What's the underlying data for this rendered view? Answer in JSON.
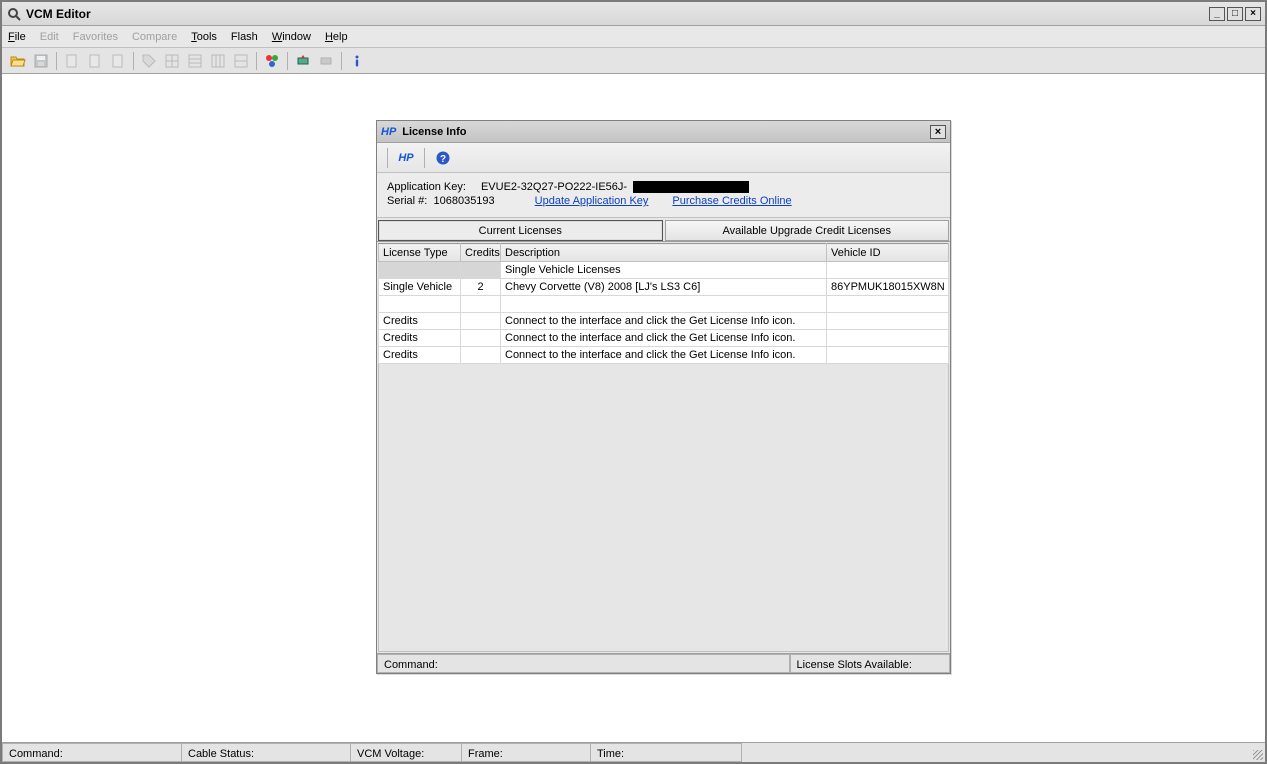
{
  "app": {
    "title": "VCM Editor"
  },
  "menu": {
    "file": "File",
    "edit": "Edit",
    "favorites": "Favorites",
    "compare": "Compare",
    "tools": "Tools",
    "flash": "Flash",
    "window": "Window",
    "help": "Help"
  },
  "status": {
    "command": "Command:",
    "cable": "Cable Status:",
    "voltage": "VCM Voltage:",
    "frame": "Frame:",
    "time": "Time:"
  },
  "dialog": {
    "title": "License Info",
    "appkey_label": "Application Key:",
    "appkey_value": "EVUE2-32Q27-PO222-IE56J-",
    "serial_label": "Serial #:",
    "serial_value": "1068035193",
    "link_update": "Update Application Key",
    "link_purchase": "Purchase Credits Online",
    "tabs": {
      "current": "Current Licenses",
      "available": "Available Upgrade Credit Licenses"
    },
    "columns": {
      "type": "License Type",
      "credits": "Credits",
      "description": "Description",
      "vehicle": "Vehicle ID"
    },
    "rows": [
      {
        "type": "",
        "credits": "",
        "description": "Single Vehicle Licenses",
        "vehicle": ""
      },
      {
        "type": "Single Vehicle",
        "credits": "2",
        "description": "Chevy  Corvette  (V8)  2008          [LJ's LS3 C6]",
        "vehicle": "86YPMUK18015XW8N"
      },
      {
        "type": "",
        "credits": "",
        "description": "",
        "vehicle": ""
      },
      {
        "type": "Credits",
        "credits": "",
        "description": "Connect to the interface and click the Get License Info icon.",
        "vehicle": ""
      },
      {
        "type": "Credits",
        "credits": "",
        "description": "Connect to the interface and click the Get License Info icon.",
        "vehicle": ""
      },
      {
        "type": "Credits",
        "credits": "",
        "description": "Connect to the interface and click the Get License Info icon.",
        "vehicle": ""
      }
    ],
    "status_left": "Command:",
    "status_right": "License Slots Available:"
  }
}
